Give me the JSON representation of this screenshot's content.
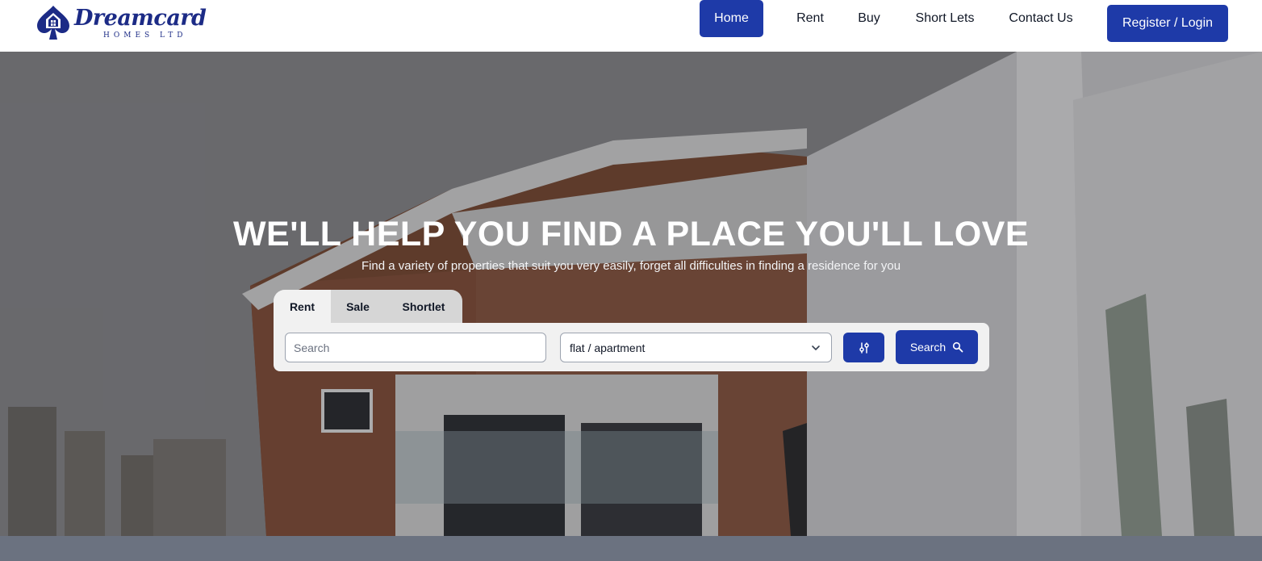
{
  "brand": {
    "name": "Dreamcard",
    "sub": "HOMES LTD",
    "color": "#1c2b86"
  },
  "nav": {
    "items": [
      {
        "label": "Home",
        "active": true
      },
      {
        "label": "Rent",
        "active": false
      },
      {
        "label": "Buy",
        "active": false
      },
      {
        "label": "Short Lets",
        "active": false
      },
      {
        "label": "Contact Us",
        "active": false
      }
    ],
    "register_label": "Register / Login",
    "accent": "#1e3aa8"
  },
  "hero": {
    "title": "WE'LL HELP YOU FIND A PLACE YOU'LL LOVE",
    "subtitle": "Find a variety of properties that suit you very easily, forget all difficulties in finding a residence for you"
  },
  "search": {
    "tabs": [
      {
        "label": "Rent",
        "active": true
      },
      {
        "label": "Sale",
        "active": false
      },
      {
        "label": "Shortlet",
        "active": false
      }
    ],
    "placeholder": "Search",
    "property_type": "flat / apartment",
    "button_label": "Search",
    "filter_icon": "sliders-icon",
    "search_icon": "magnifier-icon"
  }
}
